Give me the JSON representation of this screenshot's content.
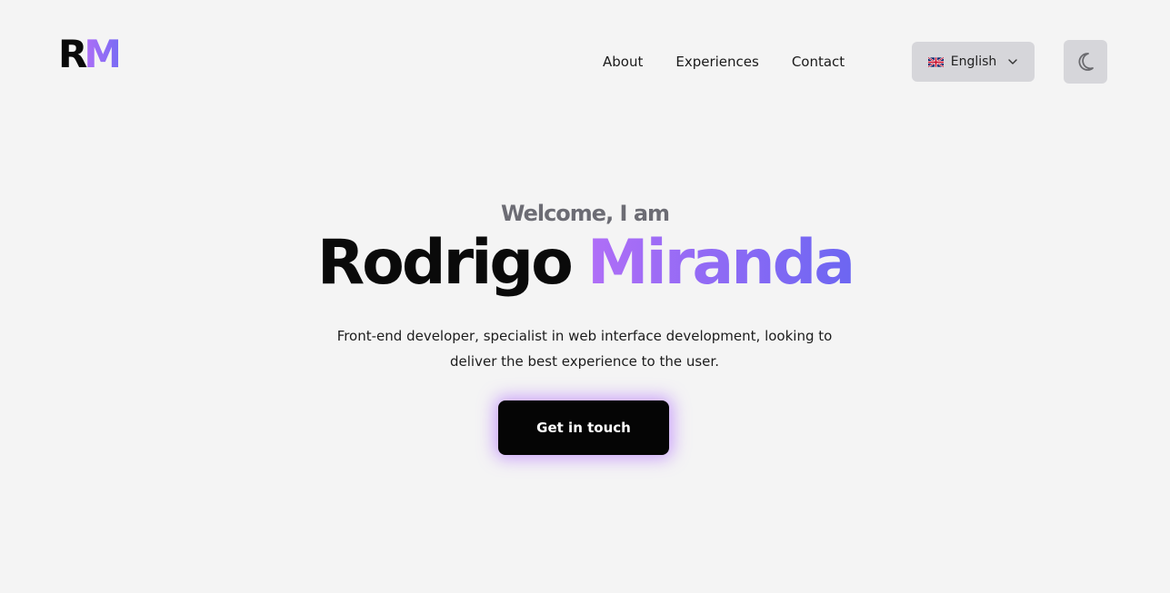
{
  "header": {
    "logo": {
      "letter1": "R",
      "letter2": "M"
    },
    "nav": [
      {
        "label": "About"
      },
      {
        "label": "Experiences"
      },
      {
        "label": "Contact"
      }
    ],
    "language": {
      "flag_icon": "uk-flag-icon",
      "label": "English",
      "chevron_icon": "chevron-down-icon"
    },
    "theme_toggle": {
      "icon": "moon-icon"
    }
  },
  "hero": {
    "welcome": "Welcome, I am",
    "first_name": "Rodrigo",
    "last_name": "Miranda",
    "description": "Front-end developer, specialist in web interface development, looking to deliver the best experience to the user.",
    "cta_label": "Get in touch"
  },
  "colors": {
    "background": "#f4f4f4",
    "accent_start": "#b06ef7",
    "accent_end": "#6c66f2",
    "button_bg": "#050505",
    "chip_bg": "#d6d6da"
  }
}
